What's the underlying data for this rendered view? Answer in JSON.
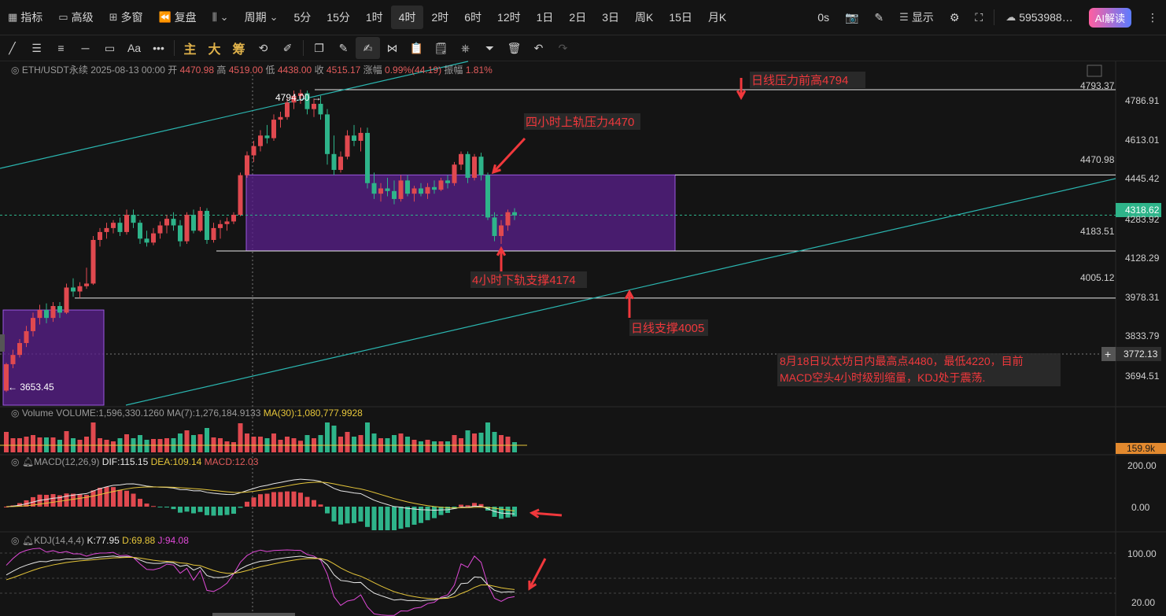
{
  "toolbar": {
    "left": [
      {
        "icon": "indicator-icon",
        "label": "指标"
      },
      {
        "icon": "advanced-icon",
        "label": "高级"
      },
      {
        "icon": "multi-window-icon",
        "label": "多窗"
      },
      {
        "icon": "replay-icon",
        "label": "复盘"
      },
      {
        "icon": "chart-style-icon",
        "label": ""
      },
      {
        "icon": "",
        "label": "周期"
      }
    ],
    "periods": [
      "5分",
      "15分",
      "1时",
      "4时",
      "2时",
      "6时",
      "12时",
      "1日",
      "2日",
      "3日",
      "周K",
      "15日",
      "月K"
    ],
    "active_period": "4时",
    "right": {
      "countdown": "0s",
      "display_label": "显示",
      "account": "5953988…",
      "ai_button": "AI解读"
    }
  },
  "drawing_tools": {
    "gold_labels": [
      "主",
      "大",
      "筹"
    ],
    "font_tool_label": "Aa"
  },
  "info_bar": {
    "symbol": "ETH/USDT永续",
    "datetime": "2025-08-13 00:00",
    "open_label": "开",
    "open": "4470.98",
    "high_label": "高",
    "high": "4519.00",
    "low_label": "低",
    "low": "4438.00",
    "close_label": "收",
    "close": "4515.17",
    "change_label": "涨幅",
    "change": "0.99%(44.19)",
    "amplitude_label": "振幅",
    "amplitude": "1.81%"
  },
  "price_axis": {
    "labels": [
      "4793.37",
      "4786.91",
      "4613.01",
      "4470.98",
      "4445.42",
      "4318.62",
      "4283.92",
      "4183.51",
      "4128.29",
      "4005.12",
      "3978.31",
      "3833.79",
      "3772.13",
      "3694.51"
    ],
    "current_price": "4318.62",
    "hover_price": "3772.13"
  },
  "annotations": {
    "high_marker": "4794.00",
    "low_marker": "3653.45",
    "daily_resistance": "日线压力前高4794",
    "h4_upper": "四小时上轨压力4470",
    "h4_lower": "4小时下轨支撑4174",
    "daily_support": "日线支撑4005",
    "comment_line1": "8月18日以太坊日内最高点4480，最低4220，目前",
    "comment_line2": "MACD空头4小时级别缩量，KDJ处于震荡."
  },
  "volume": {
    "title": "Volume",
    "volume_text": "VOLUME:1,596,330.1260",
    "ma7_text": "MA(7):1,276,184.9133",
    "ma30_text": "MA(30):1,080,777.9928",
    "axis_label": "159.9k"
  },
  "macd": {
    "title": "MACD(12,26,9)",
    "dif_text": "DIF:115.15",
    "dea_text": "DEA:109.14",
    "macd_text": "MACD:12.03",
    "axis_labels": [
      "200.00",
      "0.00"
    ]
  },
  "kdj": {
    "title": "KDJ(14,4,4)",
    "k_text": "K:77.95",
    "d_text": "D:69.88",
    "j_text": "J:94.08",
    "axis_labels": [
      "100.00",
      "20.00"
    ]
  },
  "colors": {
    "up": "#e0494f",
    "down": "#2eb48a",
    "zone": "#5a1f8c",
    "zone_border": "#9b59e0",
    "trendline": "#2bb6b0",
    "annotation": "#f0383c",
    "ma30": "#e6c63a",
    "pink": "#e04ad8"
  },
  "chart_data": {
    "type": "candlestick",
    "symbol": "ETH/USDT永续",
    "interval": "4时",
    "ylim": [
      3600,
      4850
    ],
    "price_levels": {
      "daily_resistance": 4793.37,
      "h4_upper": 4470.98,
      "h4_lower": 4183.51,
      "daily_support": 4005.12,
      "current": 4318.62
    },
    "candles": [
      [
        3655,
        3760,
        3650,
        3755
      ],
      [
        3755,
        3810,
        3740,
        3790
      ],
      [
        3790,
        3850,
        3780,
        3835
      ],
      [
        3835,
        3900,
        3820,
        3880
      ],
      [
        3880,
        3950,
        3860,
        3930
      ],
      [
        3930,
        3980,
        3905,
        3960
      ],
      [
        3960,
        3985,
        3910,
        3930
      ],
      [
        3930,
        3990,
        3915,
        3975
      ],
      [
        3975,
        3990,
        3930,
        3950
      ],
      [
        3950,
        4060,
        3945,
        4045
      ],
      [
        4045,
        4080,
        4010,
        4030
      ],
      [
        4030,
        4065,
        4005,
        4050
      ],
      [
        4050,
        4120,
        4040,
        4060
      ],
      [
        4060,
        4240,
        4055,
        4225
      ],
      [
        4225,
        4270,
        4200,
        4255
      ],
      [
        4255,
        4290,
        4230,
        4270
      ],
      [
        4270,
        4300,
        4250,
        4290
      ],
      [
        4290,
        4310,
        4240,
        4255
      ],
      [
        4255,
        4340,
        4245,
        4320
      ],
      [
        4320,
        4340,
        4270,
        4290
      ],
      [
        4290,
        4300,
        4210,
        4230
      ],
      [
        4230,
        4260,
        4200,
        4215
      ],
      [
        4215,
        4270,
        4205,
        4250
      ],
      [
        4250,
        4295,
        4230,
        4280
      ],
      [
        4280,
        4320,
        4250,
        4305
      ],
      [
        4305,
        4330,
        4260,
        4280
      ],
      [
        4280,
        4300,
        4200,
        4220
      ],
      [
        4220,
        4330,
        4210,
        4320
      ],
      [
        4320,
        4340,
        4250,
        4260
      ],
      [
        4260,
        4350,
        4255,
        4335
      ],
      [
        4335,
        4345,
        4210,
        4225
      ],
      [
        4225,
        4290,
        4215,
        4270
      ],
      [
        4270,
        4300,
        4230,
        4285
      ],
      [
        4285,
        4310,
        4260,
        4295
      ],
      [
        4295,
        4330,
        4285,
        4320
      ],
      [
        4320,
        4480,
        4315,
        4470
      ],
      [
        4470,
        4560,
        4460,
        4545
      ],
      [
        4545,
        4600,
        4520,
        4580
      ],
      [
        4580,
        4640,
        4560,
        4620
      ],
      [
        4620,
        4660,
        4590,
        4610
      ],
      [
        4610,
        4700,
        4600,
        4680
      ],
      [
        4680,
        4710,
        4650,
        4690
      ],
      [
        4690,
        4760,
        4680,
        4745
      ],
      [
        4745,
        4790,
        4720,
        4770
      ],
      [
        4770,
        4794,
        4740,
        4780
      ],
      [
        4780,
        4790,
        4700,
        4720
      ],
      [
        4720,
        4760,
        4690,
        4740
      ],
      [
        4740,
        4770,
        4680,
        4700
      ],
      [
        4700,
        4720,
        4510,
        4550
      ],
      [
        4550,
        4620,
        4470,
        4490
      ],
      [
        4490,
        4560,
        4480,
        4540
      ],
      [
        4540,
        4640,
        4530,
        4620
      ],
      [
        4620,
        4660,
        4580,
        4600
      ],
      [
        4600,
        4650,
        4560,
        4630
      ],
      [
        4630,
        4650,
        4420,
        4440
      ],
      [
        4440,
        4480,
        4380,
        4400
      ],
      [
        4400,
        4440,
        4370,
        4420
      ],
      [
        4420,
        4460,
        4390,
        4410
      ],
      [
        4410,
        4450,
        4360,
        4380
      ],
      [
        4380,
        4470,
        4370,
        4450
      ],
      [
        4450,
        4470,
        4390,
        4400
      ],
      [
        4400,
        4430,
        4370,
        4420
      ],
      [
        4420,
        4440,
        4390,
        4400
      ],
      [
        4400,
        4440,
        4380,
        4425
      ],
      [
        4425,
        4450,
        4400,
        4415
      ],
      [
        4415,
        4460,
        4410,
        4450
      ],
      [
        4450,
        4470,
        4420,
        4440
      ],
      [
        4440,
        4520,
        4430,
        4510
      ],
      [
        4510,
        4560,
        4490,
        4550
      ],
      [
        4550,
        4560,
        4440,
        4460
      ],
      [
        4460,
        4550,
        4450,
        4540
      ],
      [
        4540,
        4555,
        4450,
        4470
      ],
      [
        4470,
        4480,
        4300,
        4310
      ],
      [
        4310,
        4330,
        4220,
        4240
      ],
      [
        4240,
        4300,
        4210,
        4280
      ],
      [
        4280,
        4340,
        4260,
        4330
      ],
      [
        4330,
        4345,
        4300,
        4318
      ]
    ],
    "volume_ma30": 1080777.9928,
    "macd": {
      "dif": 115.15,
      "dea": 109.14,
      "macd": 12.03
    },
    "kdj": {
      "k": 77.95,
      "d": 69.88,
      "j": 94.08
    }
  }
}
